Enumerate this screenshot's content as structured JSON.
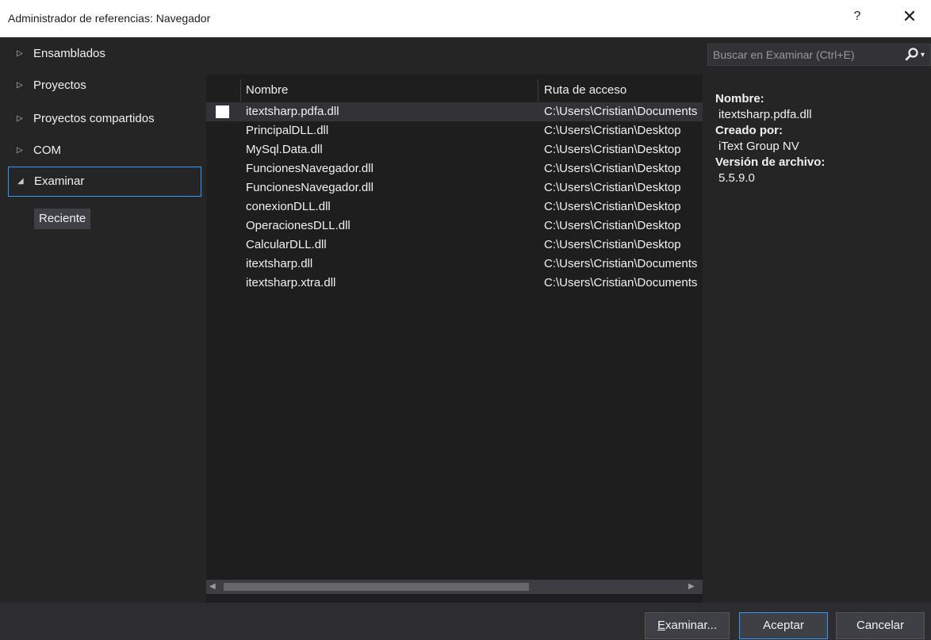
{
  "window": {
    "title": "Administrador de referencias: Navegador",
    "help_label": "?",
    "close_label": "✕"
  },
  "sidebar": {
    "items": [
      {
        "label": "Ensamblados",
        "expanded": false
      },
      {
        "label": "Proyectos",
        "expanded": false
      },
      {
        "label": "Proyectos compartidos",
        "expanded": false
      },
      {
        "label": "COM",
        "expanded": false
      },
      {
        "label": "Examinar",
        "expanded": true,
        "selected": true
      }
    ],
    "collapsed_glyph": "▷",
    "expanded_glyph": "◢",
    "sub_items": [
      {
        "label": "Reciente"
      }
    ]
  },
  "list": {
    "columns": {
      "name": "Nombre",
      "path": "Ruta de acceso"
    },
    "rows": [
      {
        "name": "itextsharp.pdfa.dll",
        "path": "C:\\Users\\Cristian\\Documents",
        "checkbox": true,
        "selected": true
      },
      {
        "name": "PrincipalDLL.dll",
        "path": "C:\\Users\\Cristian\\Desktop"
      },
      {
        "name": "MySql.Data.dll",
        "path": "C:\\Users\\Cristian\\Desktop"
      },
      {
        "name": "FuncionesNavegador.dll",
        "path": "C:\\Users\\Cristian\\Desktop"
      },
      {
        "name": "FuncionesNavegador.dll",
        "path": "C:\\Users\\Cristian\\Desktop"
      },
      {
        "name": "conexionDLL.dll",
        "path": "C:\\Users\\Cristian\\Desktop"
      },
      {
        "name": "OperacionesDLL.dll",
        "path": "C:\\Users\\Cristian\\Desktop"
      },
      {
        "name": "CalcularDLL.dll",
        "path": "C:\\Users\\Cristian\\Desktop"
      },
      {
        "name": "itextsharp.dll",
        "path": "C:\\Users\\Cristian\\Documents"
      },
      {
        "name": "itextsharp.xtra.dll",
        "path": "C:\\Users\\Cristian\\Documents"
      }
    ],
    "scrollbar": {
      "left_arrow": "◀",
      "right_arrow": "▶"
    }
  },
  "search": {
    "placeholder": "Buscar en Examinar (Ctrl+E)",
    "value": "",
    "dropdown_glyph": "▾"
  },
  "details": {
    "name_label": "Nombre:",
    "name_value": "itextsharp.pdfa.dll",
    "created_label": "Creado por:",
    "created_value": "iText Group NV",
    "version_label": "Versión de archivo:",
    "version_value": "5.5.9.0"
  },
  "buttons": {
    "browse_accel": "E",
    "browse_rest": "xaminar...",
    "ok": "Aceptar",
    "cancel": "Cancelar"
  },
  "colors": {
    "background": "#252526",
    "list_background": "#1e1e1e",
    "accent": "#3399ff",
    "text": "#f1f1f1"
  }
}
